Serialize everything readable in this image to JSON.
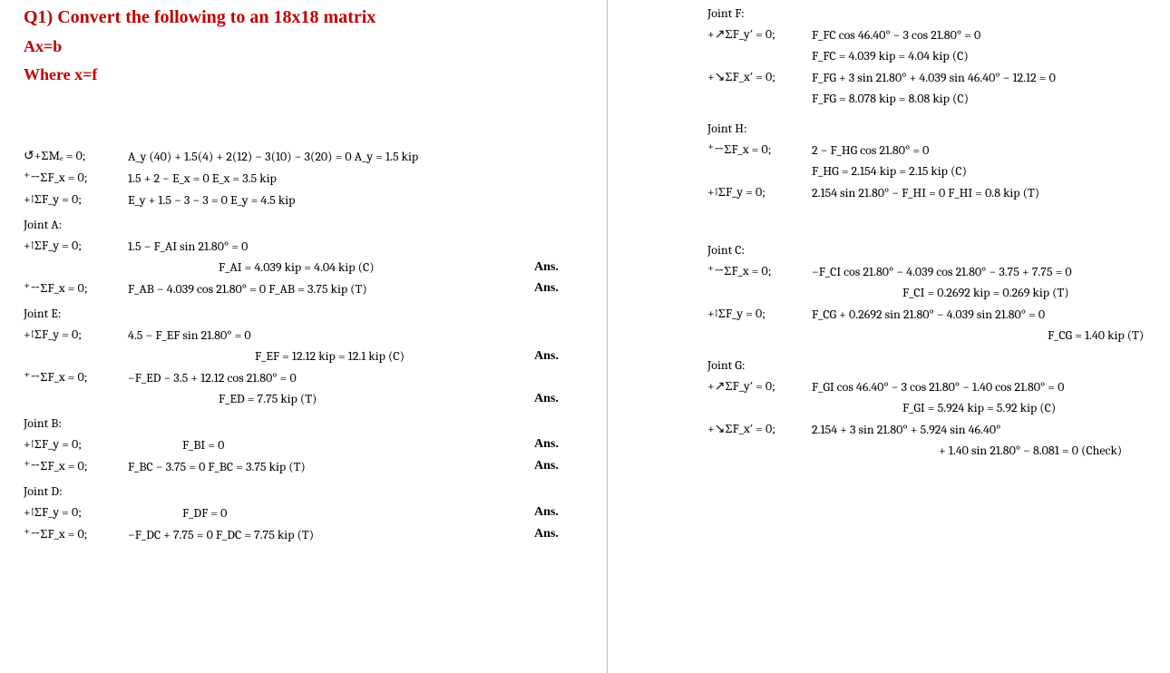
{
  "question": {
    "title": "Q1) Convert the following to an 18x18 matrix",
    "eq": "Ax=b",
    "where": "Where x=f"
  },
  "left": {
    "l1_lbl": "↺+ΣMₑ = 0;",
    "l1_eq": "A_y (40) + 1.5(4) + 2(12) − 3(10) − 3(20) = 0      A_y = 1.5 kip",
    "l2_lbl": "⁺→ΣF_x = 0;",
    "l2_eq": "1.5 + 2 − E_x = 0      E_x = 3.5 kip",
    "l3_lbl": "+↑ΣF_y = 0;",
    "l3_eq": "E_y + 1.5 − 3 − 3 = 0      E_y = 4.5 kip",
    "jA": "Joint A:",
    "a1_lbl": "+↑ΣF_y = 0;",
    "a1_eq": "1.5 − F_AI sin 21.80° = 0",
    "a2_eq": "F_AI = 4.039 kip = 4.04 kip (C)",
    "a3_lbl": "⁺→ΣF_x = 0;",
    "a3_eq": "F_AB − 4.039 cos 21.80° = 0      F_AB = 3.75 kip (T)",
    "jE": "Joint E:",
    "e1_lbl": "+↑ΣF_y = 0;",
    "e1_eq": "4.5 − F_EF sin 21.80° = 0",
    "e2_eq": "F_EF = 12.12 kip = 12.1 kip (C)",
    "e3_lbl": "⁺→ΣF_x = 0;",
    "e3_eq": "−F_ED − 3.5 + 12.12 cos 21.80° = 0",
    "e4_eq": "F_ED = 7.75 kip (T)",
    "jB": "Joint B:",
    "b1_lbl": "+↑ΣF_y = 0;",
    "b1_eq": "F_BI = 0",
    "b2_lbl": "⁺→ΣF_x = 0;",
    "b2_eq": "F_BC − 3.75 = 0      F_BC = 3.75 kip (T)",
    "jD": "Joint D:",
    "d1_lbl": "+↑ΣF_y = 0;",
    "d1_eq": "F_DF = 0",
    "d2_lbl": "⁺→ΣF_x = 0;",
    "d2_eq": "−F_DC + 7.75 = 0      F_DC = 7.75 kip (T)",
    "ans": "Ans."
  },
  "right": {
    "jF": "Joint F:",
    "f1_lbl": "+↗ΣF_y′ = 0;",
    "f1_eq": "F_FC cos 46.40° − 3 cos 21.80° = 0",
    "f2_eq": "F_FC = 4.039 kip = 4.04 kip (C)",
    "f3_lbl": "+↘ΣF_x′ = 0;",
    "f3_eq": "F_FG + 3 sin 21.80° + 4.039 sin 46.40° − 12.12 = 0",
    "f4_eq": "F_FG = 8.078 kip = 8.08 kip (C)",
    "jH": "Joint H:",
    "h1_lbl": "⁺→ΣF_x = 0;",
    "h1_eq": "2 − F_HG cos 21.80° = 0",
    "h2_eq": "F_HG = 2.154 kip = 2.15 kip (C)",
    "h3_lbl": "+↑ΣF_y = 0;",
    "h3_eq": "2.154 sin 21.80° − F_HI = 0      F_HI = 0.8 kip (T)",
    "jC": "Joint C:",
    "c1_lbl": "⁺→ΣF_x = 0;",
    "c1_eq": "−F_CI cos 21.80° − 4.039 cos 21.80° − 3.75 + 7.75 = 0",
    "c2_eq": "F_CI = 0.2692 kip = 0.269 kip (T)",
    "c3_lbl": "+↑ΣF_y = 0;",
    "c3_eq": "F_CG + 0.2692 sin 21.80° − 4.039 sin 21.80° = 0",
    "c4_eq": "F_CG = 1.40 kip (T)",
    "jG": "Joint G:",
    "g1_lbl": "+↗ΣF_y′ = 0;",
    "g1_eq": "F_GI cos 46.40° − 3 cos 21.80° − 1.40 cos 21.80° = 0",
    "g2_eq": "F_GI = 5.924 kip = 5.92 kip (C)",
    "g3_lbl": "+↘ΣF_x′ = 0;",
    "g3_eq": "2.154 + 3 sin 21.80° + 5.924 sin 46.40°",
    "g4_eq": "+ 1.40 sin 21.80° − 8.081 = 0  (Check)"
  }
}
